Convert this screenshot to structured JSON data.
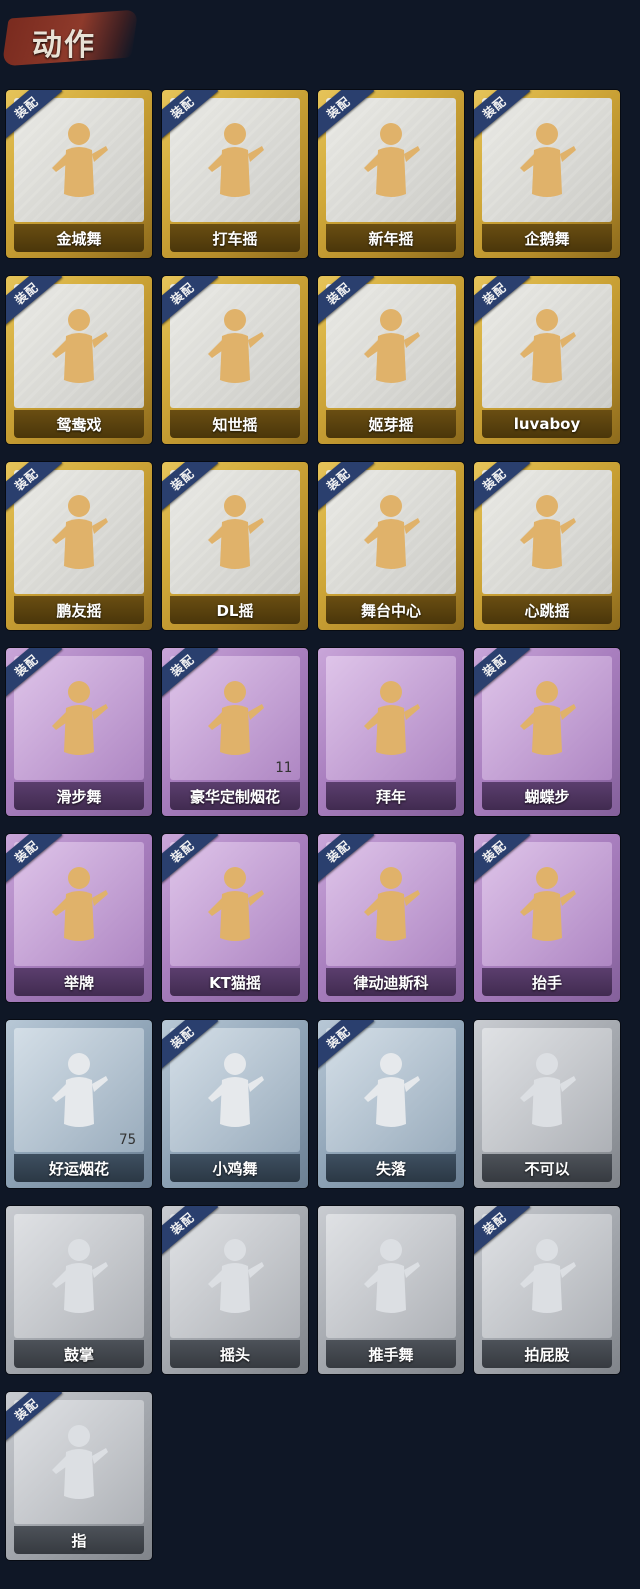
{
  "header": {
    "title": "动作"
  },
  "badge_label": "装配",
  "colors": {
    "gold": "#d2aa3a",
    "purple": "#a97fbf",
    "blue": "#8ea3b6",
    "gray": "#a4a8ae",
    "badge": "#2a3f6e"
  },
  "items": [
    {
      "name": "金城舞",
      "rarity": "gold",
      "equipped": true
    },
    {
      "name": "打车摇",
      "rarity": "gold",
      "equipped": true
    },
    {
      "name": "新年摇",
      "rarity": "gold",
      "equipped": true
    },
    {
      "name": "企鹅舞",
      "rarity": "gold",
      "equipped": true
    },
    {
      "name": "鸳鸯戏",
      "rarity": "gold",
      "equipped": true
    },
    {
      "name": "知世摇",
      "rarity": "gold",
      "equipped": true
    },
    {
      "name": "姬芽摇",
      "rarity": "gold",
      "equipped": true
    },
    {
      "name": "luvaboy",
      "rarity": "gold",
      "equipped": true
    },
    {
      "name": "鹏友摇",
      "rarity": "gold",
      "equipped": true
    },
    {
      "name": "DL摇",
      "rarity": "gold",
      "equipped": true
    },
    {
      "name": "舞台中心",
      "rarity": "gold",
      "equipped": true
    },
    {
      "name": "心跳摇",
      "rarity": "gold",
      "equipped": true
    },
    {
      "name": "滑步舞",
      "rarity": "purple",
      "equipped": true
    },
    {
      "name": "豪华定制烟花",
      "rarity": "purple",
      "equipped": true,
      "count": "11"
    },
    {
      "name": "拜年",
      "rarity": "purple",
      "equipped": false
    },
    {
      "name": "蝴蝶步",
      "rarity": "purple",
      "equipped": true
    },
    {
      "name": "举牌",
      "rarity": "purple",
      "equipped": true
    },
    {
      "name": "KT猫摇",
      "rarity": "purple",
      "equipped": true
    },
    {
      "name": "律动迪斯科",
      "rarity": "purple",
      "equipped": true
    },
    {
      "name": "抬手",
      "rarity": "purple",
      "equipped": true
    },
    {
      "name": "好运烟花",
      "rarity": "blue",
      "equipped": false,
      "count": "75"
    },
    {
      "name": "小鸡舞",
      "rarity": "blue",
      "equipped": true
    },
    {
      "name": "失落",
      "rarity": "blue",
      "equipped": true
    },
    {
      "name": "不可以",
      "rarity": "gray",
      "equipped": false
    },
    {
      "name": "鼓掌",
      "rarity": "gray",
      "equipped": false
    },
    {
      "name": "摇头",
      "rarity": "gray",
      "equipped": true
    },
    {
      "name": "推手舞",
      "rarity": "gray",
      "equipped": false
    },
    {
      "name": "拍屁股",
      "rarity": "gray",
      "equipped": true
    },
    {
      "name": "指",
      "rarity": "gray",
      "equipped": true
    }
  ]
}
